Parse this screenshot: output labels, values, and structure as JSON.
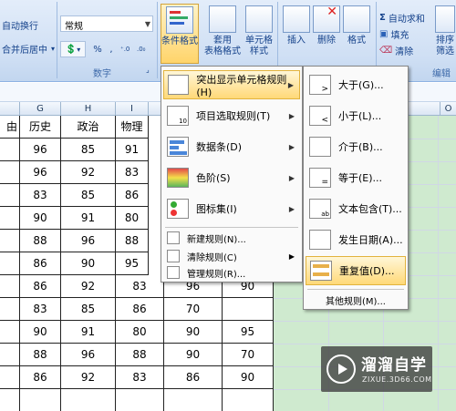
{
  "ribbon": {
    "alignment": {
      "wrap_text": "自动换行",
      "merge_center": "合并后居中",
      "merge_arrow": "▾"
    },
    "number": {
      "format_value": "常规",
      "percent": "%",
      "comma": ",",
      "increase_decimal": ".00→.0",
      "decrease_decimal": ".0→.00",
      "group_label": "数字",
      "currency_label": "▾"
    },
    "styles": {
      "conditional_format": "条件格式",
      "table_format_line1": "套用",
      "table_format_line2": "表格格式",
      "cell_styles_line1": "单元格",
      "cell_styles_line2": "样式"
    },
    "cells": {
      "insert": "插入",
      "delete": "删除",
      "format": "格式"
    },
    "editing": {
      "autosum": "自动求和",
      "fill": "填充",
      "clear": "清除",
      "sort_line1": "排序",
      "sort_line2": "筛选",
      "group_label": "编辑"
    }
  },
  "columns": {
    "headers": [
      "G",
      "H",
      "I",
      "",
      "",
      "",
      "",
      "O"
    ]
  },
  "table": {
    "header_partial": "由",
    "headers": [
      "历史",
      "政治",
      "物理"
    ],
    "rows": [
      [
        "96",
        "85",
        "91"
      ],
      [
        "96",
        "92",
        "83"
      ],
      [
        "83",
        "85",
        "86"
      ],
      [
        "90",
        "91",
        "80"
      ],
      [
        "88",
        "96",
        "88"
      ],
      [
        "86",
        "90",
        "95"
      ],
      [
        "86",
        "92",
        "83",
        "96",
        "90"
      ],
      [
        "83",
        "85",
        "86",
        "70",
        ""
      ],
      [
        "90",
        "91",
        "80",
        "90",
        "95"
      ],
      [
        "88",
        "96",
        "88",
        "90",
        "70"
      ],
      [
        "86",
        "92",
        "83",
        "86",
        "90"
      ]
    ]
  },
  "cf_menu": {
    "items": [
      {
        "label": "突出显示单元格规则(H)",
        "icon": "highlight-rules-icon"
      },
      {
        "label": "项目选取规则(T)",
        "icon": "top-bottom-rules-icon"
      },
      {
        "label": "数据条(D)",
        "icon": "data-bars-icon"
      },
      {
        "label": "色阶(S)",
        "icon": "color-scales-icon"
      },
      {
        "label": "图标集(I)",
        "icon": "icon-sets-icon"
      }
    ],
    "small_items": [
      {
        "label": "新建规则(N)..."
      },
      {
        "label": "清除规则(C)"
      },
      {
        "label": "管理规则(R)..."
      }
    ]
  },
  "sub_menu": {
    "items": [
      {
        "label": "大于(G)..."
      },
      {
        "label": "小于(L)..."
      },
      {
        "label": "介于(B)..."
      },
      {
        "label": "等于(E)..."
      },
      {
        "label": "文本包含(T)..."
      },
      {
        "label": "发生日期(A)..."
      },
      {
        "label": "重复值(D)..."
      }
    ],
    "other": "其他规则(M)..."
  },
  "watermark": {
    "title": "溜溜自学",
    "url": "ZIXUE.3D66.COM"
  },
  "colors": {
    "highlight": "#cfeacf",
    "menu_select": "#ffd978",
    "ribbon": "#cfdff4"
  }
}
